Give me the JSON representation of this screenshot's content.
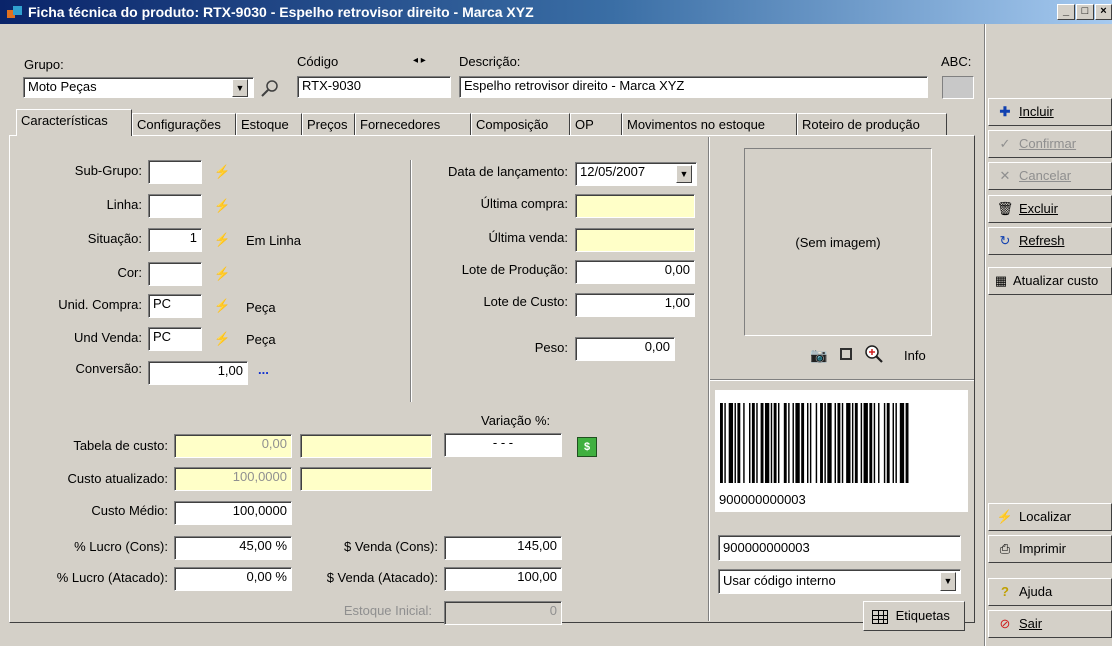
{
  "window": {
    "title": "Ficha técnica do produto: RTX-9030 - Espelho retrovisor direito - Marca XYZ"
  },
  "header": {
    "grupo_label": "Grupo:",
    "grupo_value": "Moto Peças",
    "codigo_label": "Código",
    "codigo_value": "RTX-9030",
    "descricao_label": "Descrição:",
    "descricao_value": "Espelho retrovisor direito - Marca XYZ",
    "abc_label": "ABC:"
  },
  "tabs": [
    "Características",
    "Configurações",
    "Estoque",
    "Preços",
    "Fornecedores",
    "Composição",
    "OP",
    "Movimentos no estoque",
    "Roteiro de produção"
  ],
  "left_fields": {
    "subgrupo_label": "Sub-Grupo:",
    "linha_label": "Linha:",
    "situacao_label": "Situação:",
    "situacao_value": "1",
    "situacao_desc": "Em Linha",
    "cor_label": "Cor:",
    "unid_compra_label": "Unid. Compra:",
    "unid_compra_value": "PC",
    "unid_compra_desc": "Peça",
    "und_venda_label": "Und Venda:",
    "und_venda_value": "PC",
    "und_venda_desc": "Peça",
    "conversao_label": "Conversão:",
    "conversao_value": "1,00",
    "conversao_more": "..."
  },
  "mid_fields": {
    "data_lancamento_label": "Data de lançamento:",
    "data_lancamento_value": "12/05/2007",
    "ultima_compra_label": "Última compra:",
    "ultima_venda_label": "Última venda:",
    "lote_producao_label": "Lote de Produção:",
    "lote_producao_value": "0,00",
    "lote_custo_label": "Lote de Custo:",
    "lote_custo_value": "1,00",
    "peso_label": "Peso:",
    "peso_value": "0,00"
  },
  "image_panel": {
    "placeholder": "(Sem imagem)",
    "info_label": "Info"
  },
  "cost": {
    "variacao_label": "Variação %:",
    "variacao_value": "- - -",
    "tabela_custo_label": "Tabela de custo:",
    "tabela_custo_value": "0,00",
    "custo_atualizado_label": "Custo atualizado:",
    "custo_atualizado_value": "100,0000",
    "custo_medio_label": "Custo Médio:",
    "custo_medio_value": "100,0000",
    "lucro_cons_label": "% Lucro (Cons):",
    "lucro_cons_value": "45,00 %",
    "lucro_atacado_label": "% Lucro (Atacado):",
    "lucro_atacado_value": "0,00 %",
    "venda_cons_label": "$ Venda (Cons):",
    "venda_cons_value": "145,00",
    "venda_atacado_label": "$ Venda (Atacado):",
    "venda_atacado_value": "100,00",
    "estoque_inicial_label": "Estoque Inicial:",
    "estoque_inicial_value": "0"
  },
  "barcode": {
    "caption": "900000000003",
    "code_value": "900000000003",
    "mode_value": "Usar código interno",
    "etiquetas_label": "Etiquetas"
  },
  "sidebar": {
    "incluir": "Incluir",
    "confirmar": "Confirmar",
    "cancelar": "Cancelar",
    "excluir": "Excluir",
    "refresh": "Refresh",
    "atualizar": "Atualizar custo",
    "localizar": "Localizar",
    "imprimir": "Imprimir",
    "ajuda": "Ajuda",
    "sair": "Sair"
  }
}
